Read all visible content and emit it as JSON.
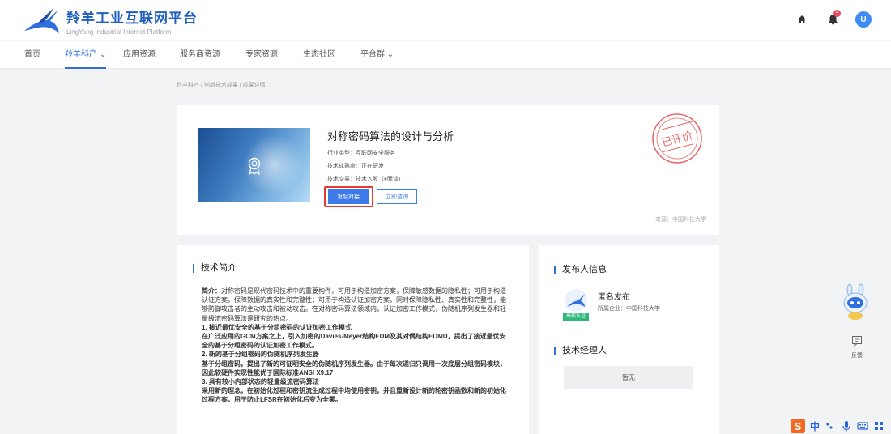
{
  "header": {
    "brand_title": "羚羊工业互联网平台",
    "brand_subtitle": "LingYang Industrial Internet Platform",
    "notification_count": "4",
    "avatar_text": "U"
  },
  "nav": {
    "items": [
      {
        "label": "首页"
      },
      {
        "label": "羚羊科产 ⌄"
      },
      {
        "label": "应用资源"
      },
      {
        "label": "服务商资源"
      },
      {
        "label": "专家资源"
      },
      {
        "label": "生态社区"
      },
      {
        "label": "平台群 ⌄"
      }
    ],
    "active_index": 1
  },
  "breadcrumb": "羚羊科产 / 创新技术成果 / 成果详情",
  "achievement": {
    "title": "对称密码算法的设计与分析",
    "industry": "行业类型：互联网安全服务",
    "maturity": "技术成熟度：正在研发",
    "trade": "技术交易：技术入股（¥面谈）",
    "initiate_button": "发起对接",
    "consult_button": "立即咨询",
    "stamp_text": "已评价",
    "source": "来源：中国科技大学"
  },
  "intro": {
    "section_title": "技术简介",
    "paragraphs": [
      {
        "text": "简介：对称密码是现代密码技术中的重要构件，可用于构造加密方案，保障敏感数据的隐私性；可用于构造认证方案，保障数据的真实性和完整性；可用于构造认证加密方案，同时保障隐私性、真实性和完整性，能够防御攻击者的主动攻击和被动攻击。在对称密码算法领域内，认证加密工作模式，伪随机序列发生器和轻量级流密码算法是研究的热点。",
        "bold": false
      },
      {
        "text": "1. 接近最优安全的基于分组密码的认证加密工作模式",
        "bold": true
      },
      {
        "text": "在广泛应用的GCM方案之上，引入加密的Davies-Meyer结构EDM及其对偶结构EDMD，提出了接近最优安全的基于分组密码的认证加密工作模式。",
        "bold": true
      },
      {
        "text": "2. 新的基于分组密码的伪随机序列发生器",
        "bold": true
      },
      {
        "text": "基于分组密码，提出了新的可证明安全的伪随机序列发生器。由于每次递归只调用一次底层分组密码模块，因此软硬件实现性能优于国际标准ANSI X9.17",
        "bold": true
      },
      {
        "text": "3. 具有较小内部状态的轻量级流密码算法",
        "bold": true
      },
      {
        "text": "采用新的理念，在初始化过程和密钥流生成过程中均使用密钥，并且重新设计新的轮密钥函数和新的初始化过程方案，用于防止LFSR在初始化后变为全零。",
        "bold": true
      }
    ]
  },
  "publisher": {
    "section_title": "发布人信息",
    "name": "匿名发布",
    "org": "所属企业：中国科技大学",
    "verify_badge": "高校认证",
    "manager_title": "技术经理人",
    "manager_value": "暂无"
  },
  "sidebar": {
    "feedback_label": "反馈"
  },
  "ime": {
    "logo": "S",
    "lang": "中"
  },
  "colors": {
    "primary": "#3d7be8",
    "brand": "#1f5fbf",
    "highlight": "#e53935",
    "verify": "#2eb87a"
  }
}
